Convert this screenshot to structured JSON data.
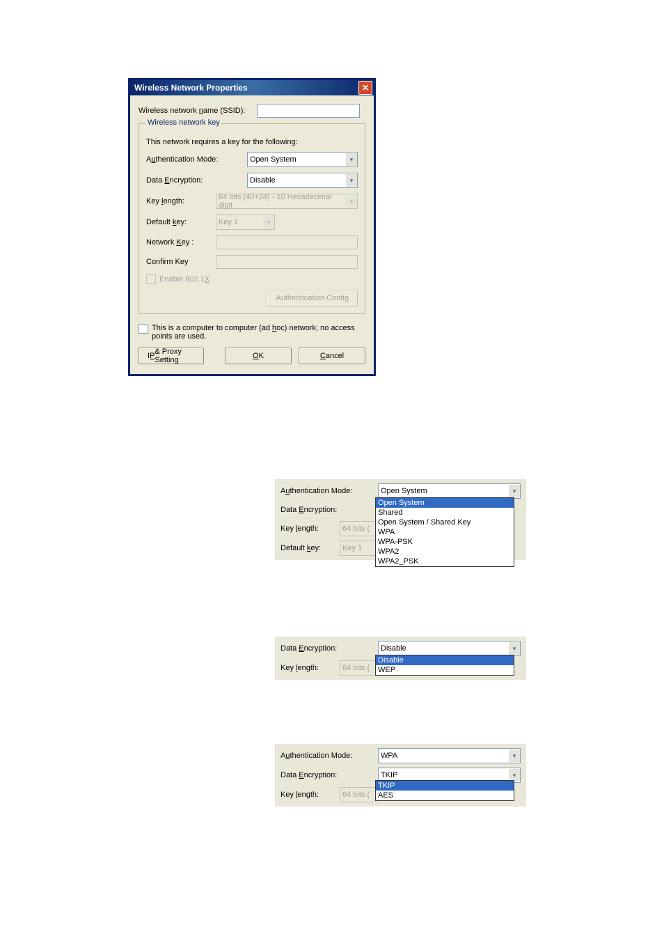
{
  "dialog": {
    "title": "Wireless Network Properties",
    "ssid_label_pre": "Wireless network ",
    "ssid_label_u": "n",
    "ssid_label_post": "ame (SSID):",
    "ssid_value": "",
    "fieldset_legend": "Wireless network key",
    "requires_note": "This network requires a key for the following:",
    "auth_label_pre": "A",
    "auth_label_u": "u",
    "auth_label_post": "thentication Mode:",
    "auth_value": "Open System",
    "enc_label_pre": "Data ",
    "enc_label_u": "E",
    "enc_label_post": "ncryption:",
    "enc_value": "Disable",
    "keylen_label_pre": "Key ",
    "keylen_label_u": "l",
    "keylen_label_post": "ength:",
    "keylen_value": "64 bits (40+24) - 10 Hexadecimal digit",
    "defkey_label_pre": "Default ",
    "defkey_label_u": "k",
    "defkey_label_post": "ey:",
    "defkey_value": "Key 1",
    "netkey_label_pre": "Network ",
    "netkey_label_u": "K",
    "netkey_label_post": "ey :",
    "confirm_label": "Confirm Key",
    "enable8021x_pre": "Enable 802.1",
    "enable8021x_u": "X",
    "authconfig_btn": "Authentication Config",
    "adhoc_pre": "This is a computer to computer (ad ",
    "adhoc_u": "h",
    "adhoc_post": "oc) network; no access points are used.",
    "ipproxy_pre": "I",
    "ipproxy_u": "P",
    "ipproxy_post": " & Proxy Setting",
    "ok_u": "O",
    "ok_post": "K",
    "cancel_u": "C",
    "cancel_post": "ancel"
  },
  "panel2": {
    "auth_label": "Authentication Mode:",
    "auth_value": "Open System",
    "enc_label": "Data Encryption:",
    "keylen_label": "Key length:",
    "keylen_disabled": "64 bits (",
    "defkey_label": "Default key:",
    "defkey_disabled": "Key 1",
    "options": [
      "Open System",
      "Shared",
      "Open System / Shared Key",
      "WPA",
      "WPA-PSK",
      "WPA2",
      "WPA2_PSK"
    ]
  },
  "panel3": {
    "enc_label": "Data Encryption:",
    "enc_value": "Disable",
    "keylen_label": "Key length:",
    "keylen_disabled": "64 bits (",
    "options": [
      "Disable",
      "WEP"
    ]
  },
  "panel4": {
    "auth_label": "Authentication Mode:",
    "auth_value": "WPA",
    "enc_label": "Data Encryption:",
    "enc_value": "TKIP",
    "keylen_label": "Key length:",
    "keylen_disabled": "64 bits (",
    "options": [
      "TKIP",
      "AES"
    ]
  }
}
